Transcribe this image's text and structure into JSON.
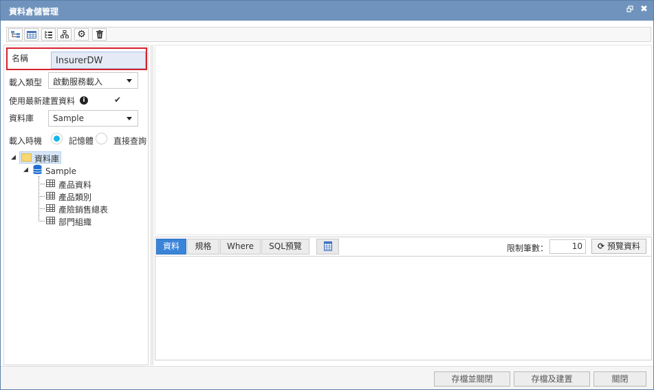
{
  "window": {
    "title": "資料倉儲管理",
    "restore_icon": "window-restore-icon",
    "close_icon": "close-icon"
  },
  "toolbar": {
    "buttons": [
      {
        "icon": "tree-view-icon"
      },
      {
        "icon": "grid-icon"
      },
      {
        "icon": "list-icon"
      },
      {
        "icon": "hierarchy-icon"
      },
      {
        "icon": "gear-icon"
      },
      {
        "icon": "trash-icon"
      }
    ]
  },
  "form": {
    "name_label": "名稱",
    "name_value": "InsurerDW",
    "load_type_label": "載入類型",
    "load_type_value": "啟動服務載入",
    "use_latest_label": "使用最新建置資料",
    "use_latest_checked": "✔",
    "database_label": "資料庫",
    "database_value": "Sample",
    "load_timing_label": "載入時機",
    "timing_option_memory": "記憶體",
    "timing_option_direct": "直接查詢"
  },
  "tree": {
    "root": "資料庫",
    "db": "Sample",
    "tables": [
      "產品資料",
      "產品類別",
      "產險銷售總表",
      "部門組織"
    ]
  },
  "bottom": {
    "tabs": [
      "資料",
      "規格",
      "Where",
      "SQL預覽"
    ],
    "limit_label": "限制筆數：",
    "limit_value": "10",
    "preview_button": "預覽資料",
    "preview_icon": "refresh-icon"
  },
  "footer": {
    "save_close": "存檔並關閉",
    "save_build": "存檔及建置",
    "close": "關閉"
  },
  "colors": {
    "titlebar": "#6f93bc",
    "active_tab": "#3a84d8",
    "highlight_border": "#d4202a",
    "radio_on": "#19b8e6"
  }
}
